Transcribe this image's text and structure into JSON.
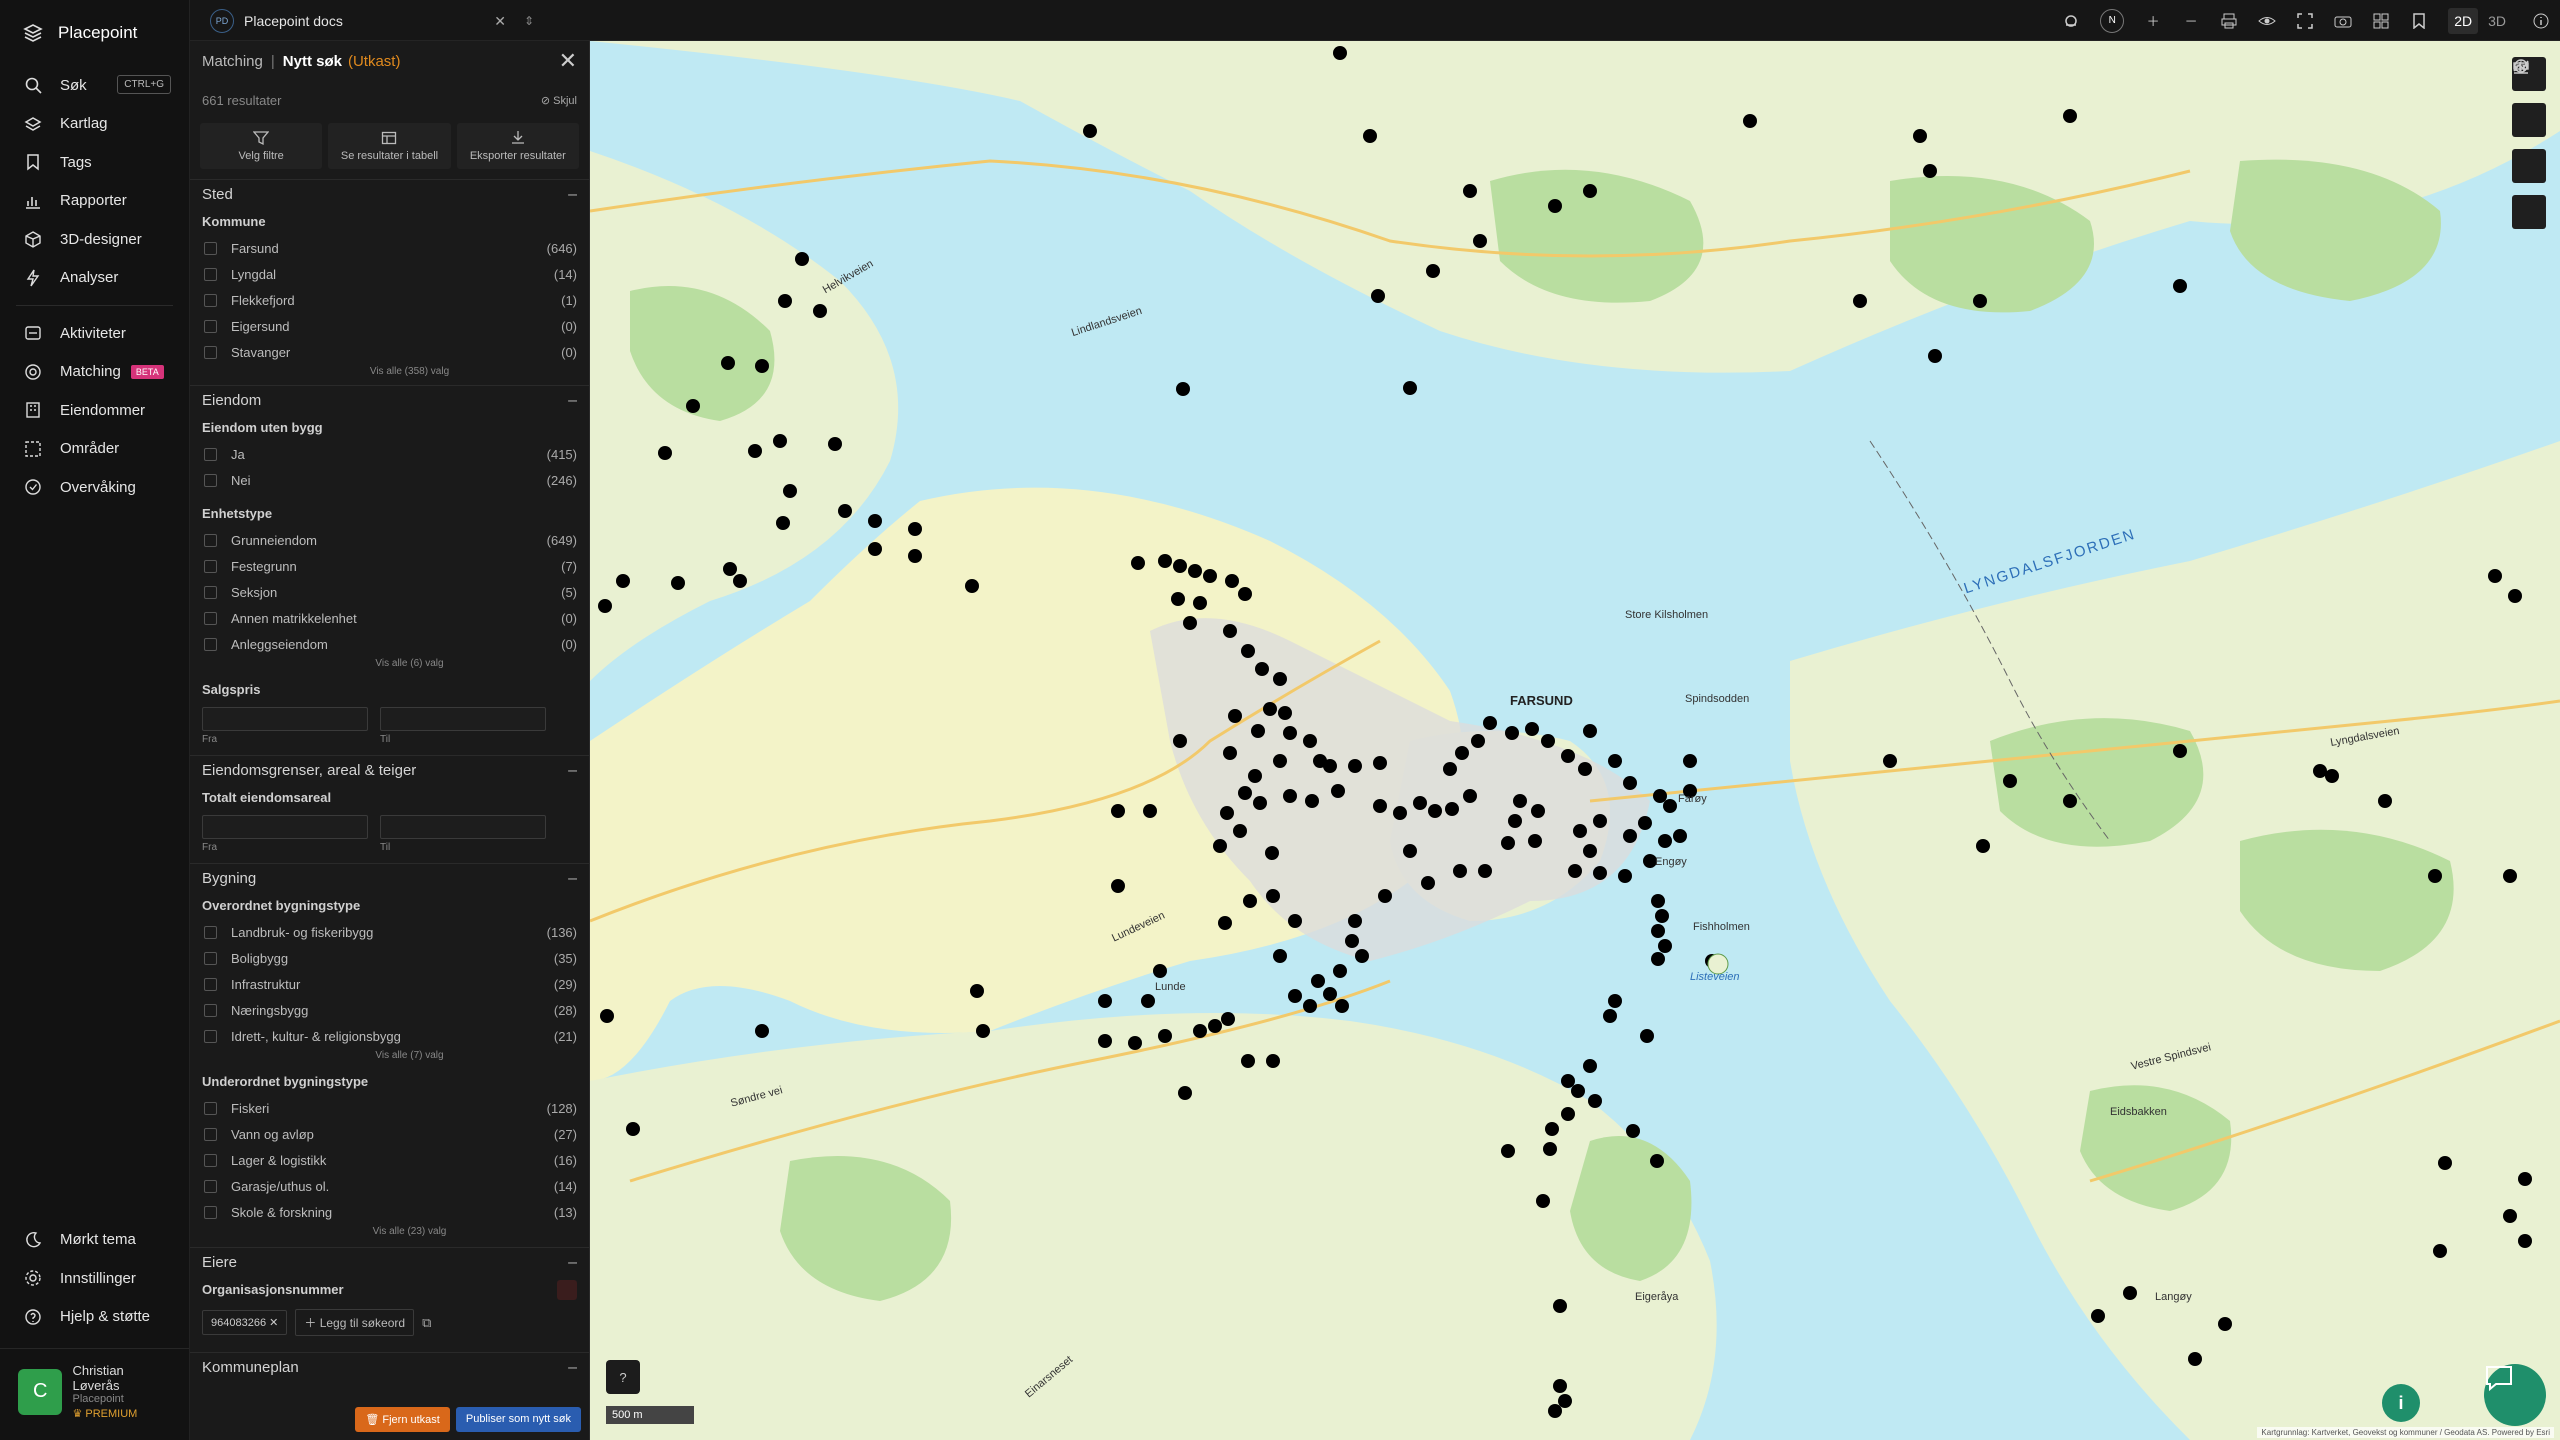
{
  "app": {
    "name": "Placepoint"
  },
  "nav": {
    "items": [
      {
        "label": "Søk",
        "shortcut": "CTRL+G",
        "icon": "search-icon"
      },
      {
        "label": "Kartlag",
        "icon": "layers-icon"
      },
      {
        "label": "Tags",
        "icon": "bookmark-icon"
      },
      {
        "label": "Rapporter",
        "icon": "chart-icon"
      },
      {
        "label": "3D-designer",
        "icon": "cube-icon"
      },
      {
        "label": "Analyser",
        "icon": "bolt-icon"
      }
    ],
    "items2": [
      {
        "label": "Aktiviteter",
        "icon": "activity-icon"
      },
      {
        "label": "Matching",
        "badge": "BETA",
        "icon": "target-icon"
      },
      {
        "label": "Eiendommer",
        "icon": "building-icon"
      },
      {
        "label": "Områder",
        "icon": "area-icon"
      },
      {
        "label": "Overvåking",
        "icon": "monitor-icon"
      }
    ],
    "bottom": [
      {
        "label": "Mørkt tema",
        "icon": "moon-icon"
      },
      {
        "label": "Innstillinger",
        "icon": "gear-icon"
      },
      {
        "label": "Hjelp & støtte",
        "icon": "help-icon"
      }
    ],
    "user": {
      "initial": "C",
      "name": "Christian Løverås",
      "org": "Placepoint",
      "plan": "PREMIUM"
    }
  },
  "topbar": {
    "tab": {
      "badge": "PD",
      "title": "Placepoint docs"
    },
    "view": {
      "two_d": "2D",
      "three_d": "3D"
    },
    "compass": "N"
  },
  "panel": {
    "breadcrumb": {
      "parent": "Matching",
      "sep": "|",
      "current": "Nytt søk",
      "status": "(Utkast)"
    },
    "results": "661 resultater",
    "hide": "Skjul",
    "actions": [
      {
        "label": "Velg filtre",
        "icon": "filter-icon"
      },
      {
        "label": "Se resultater i tabell",
        "icon": "table-icon"
      },
      {
        "label": "Eksporter resultater",
        "icon": "download-icon"
      }
    ],
    "sted": {
      "title": "Sted",
      "sub": "Kommune",
      "options": [
        {
          "label": "Farsund",
          "count": "(646)"
        },
        {
          "label": "Lyngdal",
          "count": "(14)"
        },
        {
          "label": "Flekkefjord",
          "count": "(1)"
        },
        {
          "label": "Eigersund",
          "count": "(0)"
        },
        {
          "label": "Stavanger",
          "count": "(0)"
        }
      ],
      "more": "Vis alle (358) valg"
    },
    "eiendom": {
      "title": "Eiendom",
      "sub1": "Eiendom uten bygg",
      "opts1": [
        {
          "label": "Ja",
          "count": "(415)"
        },
        {
          "label": "Nei",
          "count": "(246)"
        }
      ],
      "sub2": "Enhetstype",
      "opts2": [
        {
          "label": "Grunneiendom",
          "count": "(649)"
        },
        {
          "label": "Festegrunn",
          "count": "(7)"
        },
        {
          "label": "Seksjon",
          "count": "(5)"
        },
        {
          "label": "Annen matrikkelenhet",
          "count": "(0)"
        },
        {
          "label": "Anleggseiendom",
          "count": "(0)"
        }
      ],
      "more": "Vis alle (6) valg",
      "sub3": "Salgspris",
      "from": "Fra",
      "to": "Til"
    },
    "grenser": {
      "title": "Eiendomsgrenser, areal & teiger",
      "sub": "Totalt eiendomsareal",
      "from": "Fra",
      "to": "Til"
    },
    "bygning": {
      "title": "Bygning",
      "sub1": "Overordnet bygningstype",
      "opts1": [
        {
          "label": "Landbruk- og fiskeribygg",
          "count": "(136)"
        },
        {
          "label": "Boligbygg",
          "count": "(35)"
        },
        {
          "label": "Infrastruktur",
          "count": "(29)"
        },
        {
          "label": "Næringsbygg",
          "count": "(28)"
        },
        {
          "label": "Idrett-, kultur- & religionsbygg",
          "count": "(21)"
        }
      ],
      "more1": "Vis alle (7) valg",
      "sub2": "Underordnet bygningstype",
      "opts2": [
        {
          "label": "Fiskeri",
          "count": "(128)"
        },
        {
          "label": "Vann og avløp",
          "count": "(27)"
        },
        {
          "label": "Lager & logistikk",
          "count": "(16)"
        },
        {
          "label": "Garasje/uthus ol.",
          "count": "(14)"
        },
        {
          "label": "Skole & forskning",
          "count": "(13)"
        }
      ],
      "more2": "Vis alle (23) valg"
    },
    "eiere": {
      "title": "Eiere",
      "sub": "Organisasjonsnummer",
      "chip": "964083266",
      "add": "Legg til søkeord"
    },
    "kommuneplan": {
      "title": "Kommuneplan"
    },
    "buttons": {
      "remove": "Fjern utkast",
      "publish": "Publiser som nytt søk"
    }
  },
  "map": {
    "labels": {
      "town": "FARSUND",
      "fjord": "LYNGDALSFJORDEN",
      "a": "Store Kilsholmen",
      "b": "Lunde",
      "c": "Eidsbakken",
      "d": "Lyngdalsveien",
      "e": "Lindlandsveien",
      "f": "Søndre vei",
      "g": "Vestre Spindsvei",
      "h": "Engøy",
      "i": "Fishholmen",
      "j": "Langøy",
      "k": "Helvikveien",
      "l": "Einarsneset",
      "m": "Lundeveien",
      "n": "Farøy",
      "o": "Eigeråya",
      "p": "Spindsodden",
      "q": "Listeveien"
    },
    "scale": "500 m",
    "attribution": "Kartgrunnlag: Kartverket, Geovekst og kommuner / Geodata AS. Powered by Esri",
    "water_color": "#bfe9f3",
    "land_color": "#e9f1d2",
    "forest_color": "#b9dea0",
    "point_color": "#000000"
  }
}
